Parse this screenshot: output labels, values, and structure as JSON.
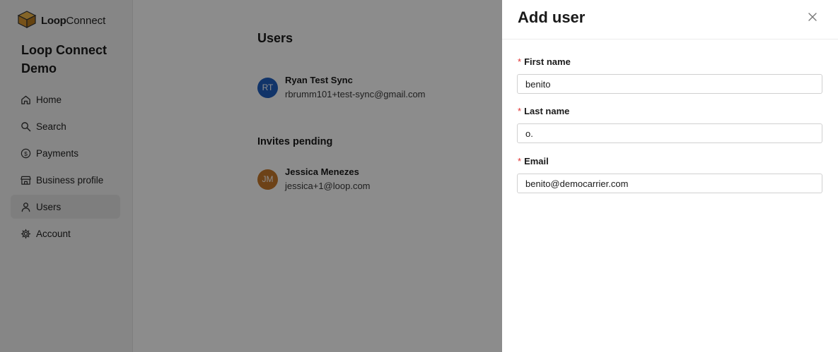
{
  "sidebar": {
    "logo_bold": "Loop",
    "logo_light": "Connect",
    "org_name": "Loop Connect Demo",
    "items": [
      {
        "label": "Home",
        "icon": "home-icon"
      },
      {
        "label": "Search",
        "icon": "search-icon"
      },
      {
        "label": "Payments",
        "icon": "dollar-icon"
      },
      {
        "label": "Business profile",
        "icon": "store-icon"
      },
      {
        "label": "Users",
        "icon": "user-icon",
        "active": true
      },
      {
        "label": "Account",
        "icon": "gear-icon"
      }
    ]
  },
  "main": {
    "users_title": "Users",
    "users": [
      {
        "initials": "RT",
        "name": "Ryan Test Sync",
        "email": "rbrumm101+test-sync@gmail.com",
        "color": "#1f5fbf"
      }
    ],
    "pending_title": "Invites pending",
    "pending": [
      {
        "initials": "JM",
        "name": "Jessica Menezes",
        "email": "jessica+1@loop.com",
        "color": "#c7782a"
      }
    ]
  },
  "drawer": {
    "title": "Add user",
    "fields": {
      "first_name": {
        "label": "First name",
        "value": "benito"
      },
      "last_name": {
        "label": "Last name",
        "value": "o."
      },
      "email": {
        "label": "Email",
        "value": "benito@democarrier.com"
      }
    }
  }
}
